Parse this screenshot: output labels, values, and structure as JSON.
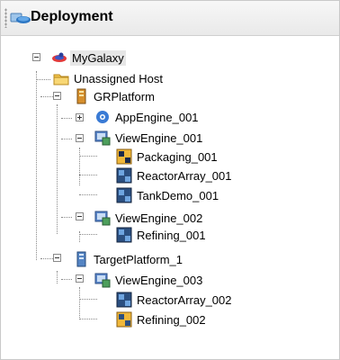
{
  "panel": {
    "title": "Deployment",
    "title_icon": "deployment-icon"
  },
  "tree": {
    "galaxy": {
      "label": "MyGalaxy",
      "icon": "galaxy-icon"
    },
    "unassigned": {
      "label": "Unassigned Host",
      "icon": "folder-icon"
    },
    "grplatform": {
      "label": "GRPlatform",
      "icon": "platform-icon"
    },
    "appengine": {
      "label": "AppEngine_001",
      "icon": "appengine-icon"
    },
    "viewengine1": {
      "label": "ViewEngine_001",
      "icon": "viewengine-icon"
    },
    "packaging": {
      "label": "Packaging_001",
      "icon": "instance-icon"
    },
    "reactor1": {
      "label": "ReactorArray_001",
      "icon": "instance-icon"
    },
    "tankdemo": {
      "label": "TankDemo_001",
      "icon": "instance-icon"
    },
    "viewengine2": {
      "label": "ViewEngine_002",
      "icon": "viewengine-icon"
    },
    "refining1": {
      "label": "Refining_001",
      "icon": "instance-icon"
    },
    "targetplatform": {
      "label": "TargetPlatform_1",
      "icon": "platform-icon"
    },
    "viewengine3": {
      "label": "ViewEngine_003",
      "icon": "viewengine-icon"
    },
    "reactor2": {
      "label": "ReactorArray_002",
      "icon": "instance-icon"
    },
    "refining2": {
      "label": "Refining_002",
      "icon": "instance-icon"
    }
  },
  "colors": {
    "selection": "#e6e6e6",
    "tree_lines": "#8a8a8a"
  }
}
